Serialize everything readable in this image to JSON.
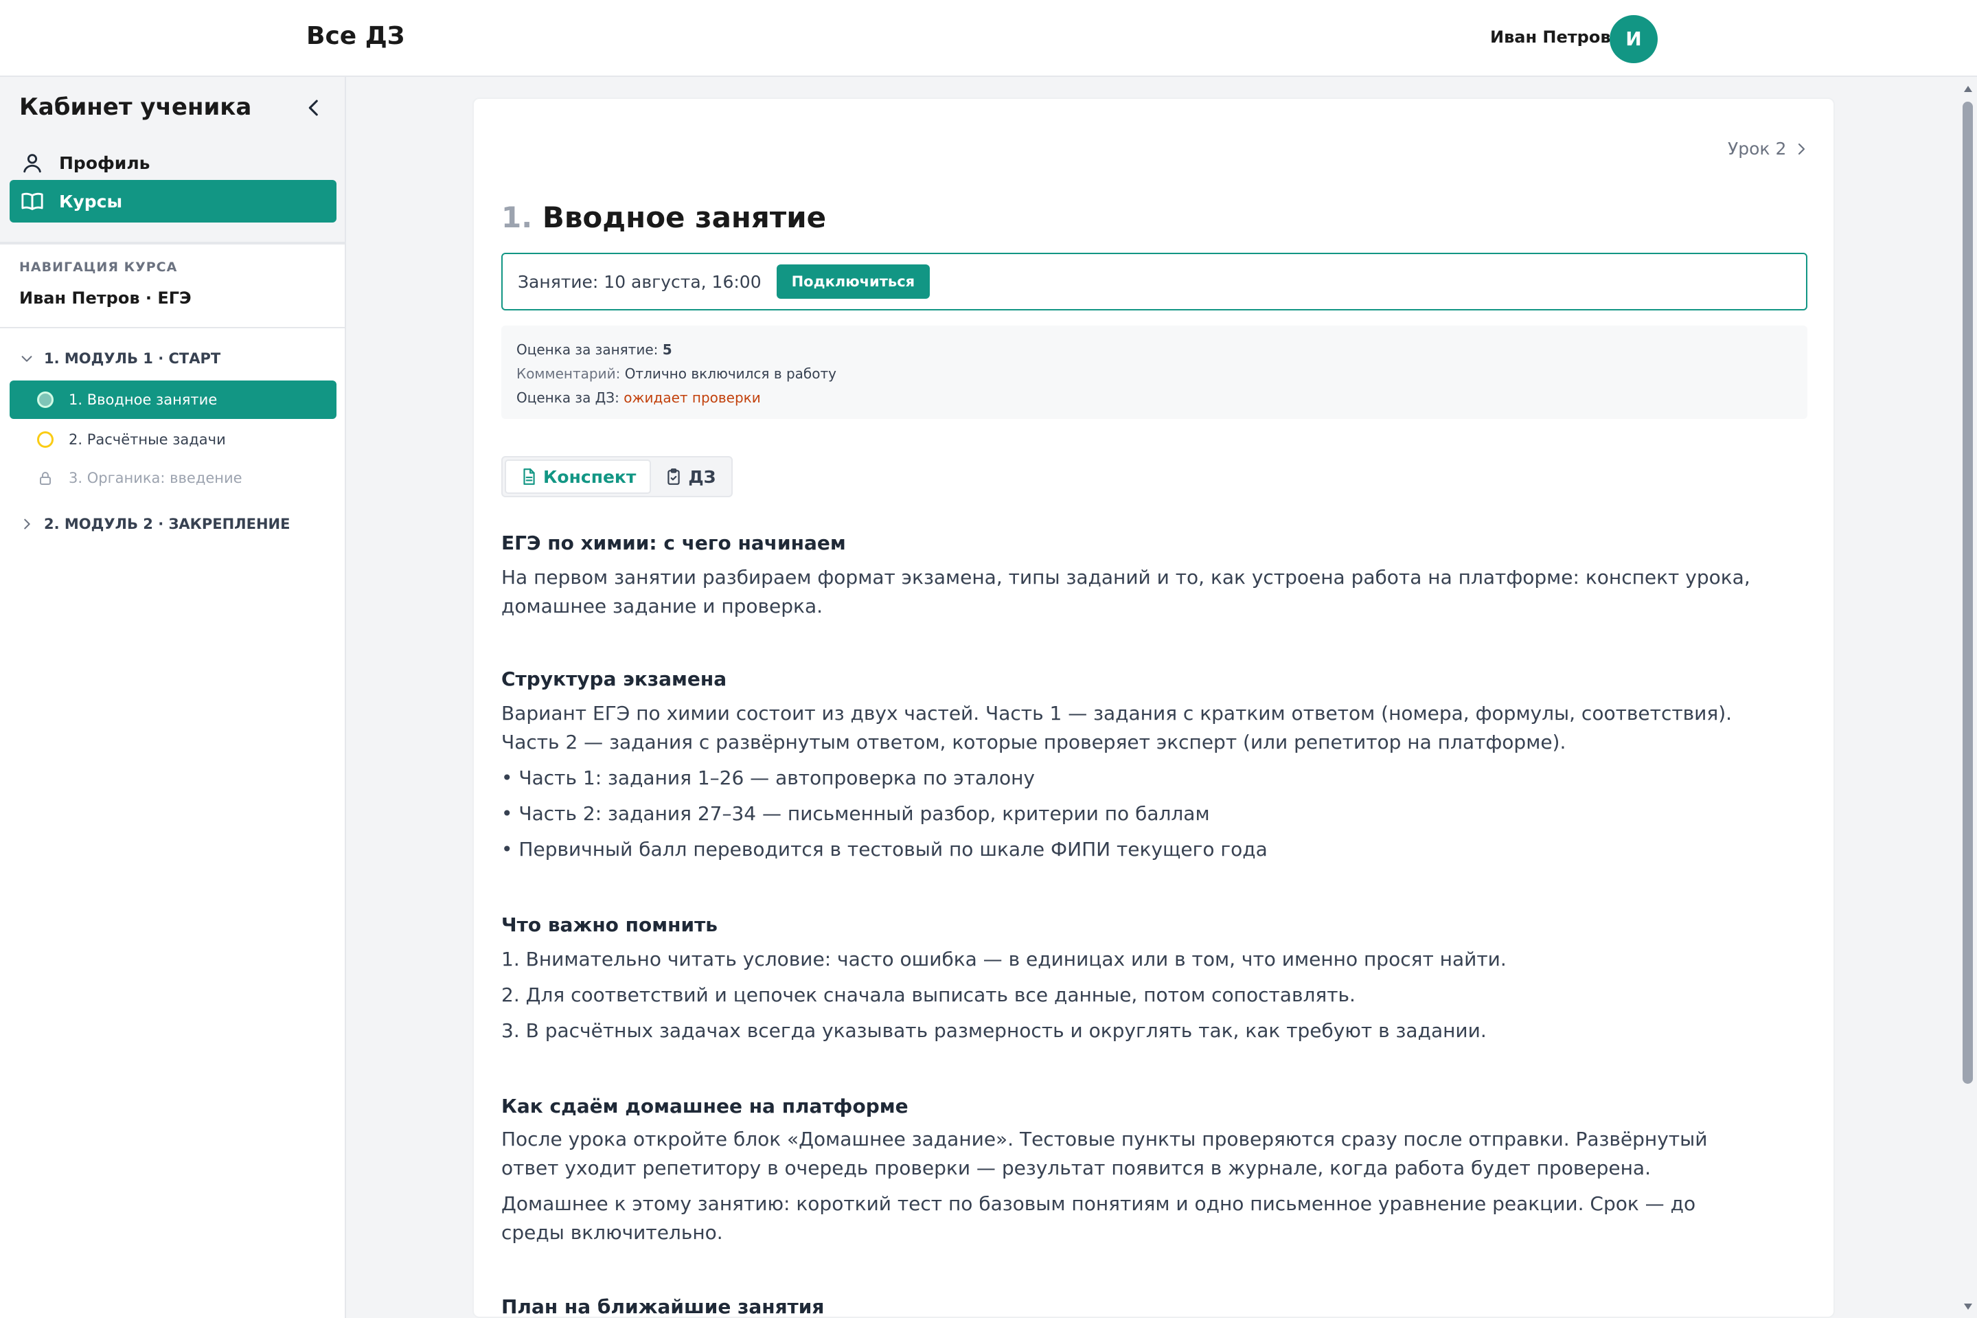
{
  "header": {
    "title": "Все ДЗ",
    "user_name": "Иван Петров",
    "avatar_letter": "И"
  },
  "sidebar": {
    "title": "Кабинет ученика",
    "nav": [
      {
        "label": "Профиль",
        "icon": "user-icon",
        "active": false
      },
      {
        "label": "Курсы",
        "icon": "book-icon",
        "active": true
      }
    ],
    "caption": "НАВИГАЦИЯ КУРСА",
    "course": "Иван Петров · ЕГЭ",
    "modules": [
      {
        "label": "1. МОДУЛЬ 1 · СТАРТ",
        "expanded": true,
        "lessons": [
          {
            "label": "1. Вводное занятие",
            "status": "active"
          },
          {
            "label": "2. Расчётные задачи",
            "status": "pending"
          },
          {
            "label": "3. Органика: введение",
            "status": "locked"
          }
        ]
      },
      {
        "label": "2. МОДУЛЬ 2 · ЗАКРЕПЛЕНИЕ",
        "expanded": false,
        "lessons": []
      }
    ]
  },
  "lesson": {
    "next_label": "Урок 2",
    "number": "1.",
    "title": "Вводное занятие",
    "session_text": "Занятие: 10 августа, 16:00",
    "connect_label": "Подключиться",
    "grade_label": "Оценка за занятие:",
    "grade_value": "5",
    "comment_label": "Комментарий:",
    "comment_value": "Отлично включился в работу",
    "hw_grade_label": "Оценка за ДЗ:",
    "hw_grade_value": "ожидает проверки",
    "tabs": [
      {
        "label": "Конспект",
        "icon": "document-icon",
        "active": true
      },
      {
        "label": "ДЗ",
        "icon": "clipboard-icon",
        "active": false
      }
    ]
  },
  "article": {
    "s1_heading": "ЕГЭ по химии: с чего начинаем",
    "s1_p1": "На первом занятии разбираем формат экзамена, типы заданий и то, как устроена работа на платформе: конспект урока, домашнее задание и проверка.",
    "s2_heading": "Структура экзамена",
    "s2_p1": "Вариант ЕГЭ по химии состоит из двух частей. Часть 1 — задания с кратким ответом (номера, формулы, соответствия). Часть 2 — задания с развёрнутым ответом, которые проверяет эксперт (или репетитор на платформе).",
    "s2_b1": "• Часть 1: задания 1–26 — автопроверка по эталону",
    "s2_b2": "• Часть 2: задания 27–34 — письменный разбор, критерии по баллам",
    "s2_b3": "• Первичный балл переводится в тестовый по шкале ФИПИ текущего года",
    "s3_heading": "Что важно помнить",
    "s3_l1": "1. Внимательно читать условие: часто ошибка — в единицах или в том, что именно просят найти.",
    "s3_l2": "2. Для соответствий и цепочек сначала выписать все данные, потом сопоставлять.",
    "s3_l3": "3. В расчётных задачах всегда указывать размерность и округлять так, как требуют в задании.",
    "s4_heading": "Как сдаём домашнее на платформе",
    "s4_p1": "После урока откройте блок «Домашнее задание». Тестовые пункты проверяются сразу после отправки. Развёрнутый ответ уходит репетитору в очередь проверки — результат появится в журнале, когда работа будет проверена.",
    "s4_p2": "Домашнее к этому занятию: короткий тест по базовым понятиям и одно письменное уравнение реакции. Срок — до среды включительно.",
    "s5_heading": "План на ближайшие занятия"
  },
  "colors": {
    "accent": "#129684",
    "pending": "#facc15",
    "warning": "#c2410c"
  }
}
